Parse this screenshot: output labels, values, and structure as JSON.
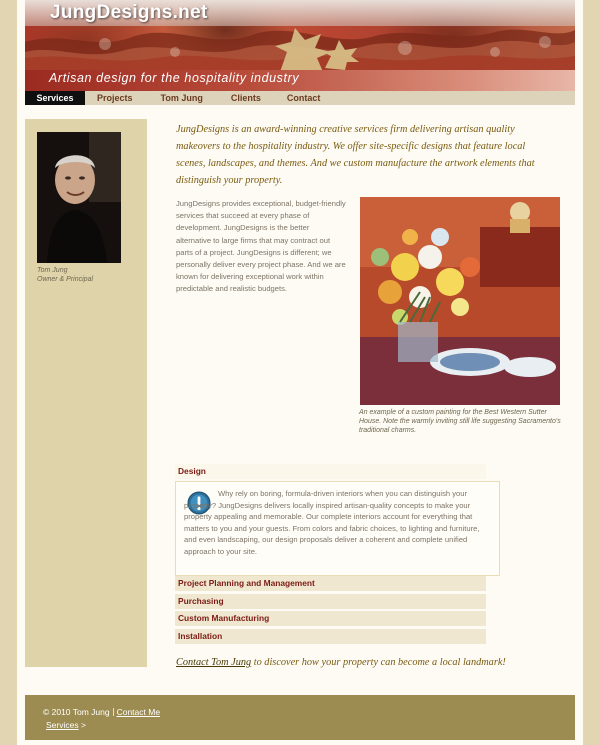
{
  "site": {
    "title": "JungDesigns.net",
    "tagline": "Artisan design for the hospitality industry"
  },
  "nav": {
    "items": [
      {
        "label": "Services",
        "active": true
      },
      {
        "label": "Projects",
        "active": false
      },
      {
        "label": "Tom Jung",
        "active": false
      },
      {
        "label": "Clients",
        "active": false
      },
      {
        "label": "Contact",
        "active": false
      }
    ]
  },
  "sidebar": {
    "caption_name": "Tom Jung",
    "caption_role": "Owner & Principal"
  },
  "main": {
    "intro": "JungDesigns is an award-winning creative services firm delivering artisan quality makeovers to the hospitality industry. We offer site-specific designs that feature local scenes, landscapes, and themes. And we custom manufacture the artwork elements that distinguish your property.",
    "body": "JungDesigns provides exceptional, budget-friendly services that succeed at every phase of development. JungDesigns is the better alternative to large firms that may contract out parts of a project. JungDesigns is different; we personally deliver every project phase. And we are known for delivering exceptional work within predictable and realistic budgets.",
    "painting_caption": "An example of a custom painting for the Best Western Sutter House. Note the warmly inviting still life suggesting Sacramento's traditional charms."
  },
  "accordion": {
    "sections": [
      {
        "label": "Design",
        "open": true
      },
      {
        "label": "Project Planning and Management",
        "open": false
      },
      {
        "label": "Purchasing",
        "open": false
      },
      {
        "label": "Custom Manufacturing",
        "open": false
      },
      {
        "label": "Installation",
        "open": false
      }
    ],
    "design_text": "Why rely on boring, formula-driven interiors when you can distinguish your property? JungDesigns delivers locally inspired artisan-quality concepts to make your property appealing and memorable. Our complete interiors account for everything that matters to you and your guests. From colors and fabric choices, to lighting and furniture, and even landscaping, our design proposals deliver a coherent and complete unified approach to your site."
  },
  "contact": {
    "link": "Contact Tom Jung",
    "rest": " to discover how your property can become a local landmark!"
  },
  "footer": {
    "copyright": "© 2010 Tom Jung",
    "contact_link": "Contact Me",
    "breadcrumb_link": "Services",
    "breadcrumb_sep": " >"
  },
  "colors": {
    "outer_background": "#e2d6b2",
    "sidebar": "#dfd3a9",
    "footer": "#9c8c52",
    "accordion_heading": "#7c1b15",
    "intro_text": "#7a5a10"
  }
}
